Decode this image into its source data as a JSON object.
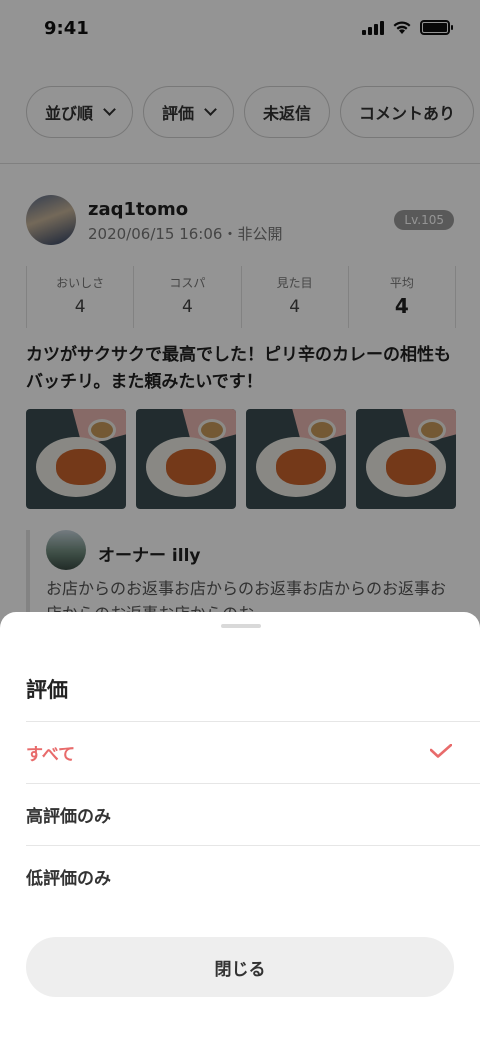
{
  "status_bar": {
    "time": "9:41"
  },
  "filters": [
    {
      "label": "並び順",
      "has_dropdown": true
    },
    {
      "label": "評価",
      "has_dropdown": true
    },
    {
      "label": "未返信",
      "has_dropdown": false
    },
    {
      "label": "コメントあり",
      "has_dropdown": false
    }
  ],
  "review": {
    "username": "zaq1tomo",
    "meta": "2020/06/15 16:06・非公開",
    "level": "Lv.105",
    "ratings": [
      {
        "label": "おいしさ",
        "value": "4"
      },
      {
        "label": "コスパ",
        "value": "4"
      },
      {
        "label": "見た目",
        "value": "4"
      },
      {
        "label": "平均",
        "value": "4"
      }
    ],
    "text": "カツがサクサクで最高でした！ピリ辛のカレーの相性もバッチリ。また頼みたいです！",
    "photo_count": 4,
    "reply": {
      "owner_name": "オーナー illy",
      "text": "お店からのお返事お店からのお返事お店からのお返事お店からのお返事お店からのお"
    }
  },
  "sheet": {
    "title": "評価",
    "options": [
      {
        "label": "すべて",
        "selected": true
      },
      {
        "label": "高評価のみ",
        "selected": false
      },
      {
        "label": "低評価のみ",
        "selected": false
      }
    ],
    "close_label": "閉じる"
  },
  "colors": {
    "accent": "#e86b6b",
    "overlay": "rgba(0,0,0,0.42)",
    "button_bg": "#eeeeee"
  }
}
